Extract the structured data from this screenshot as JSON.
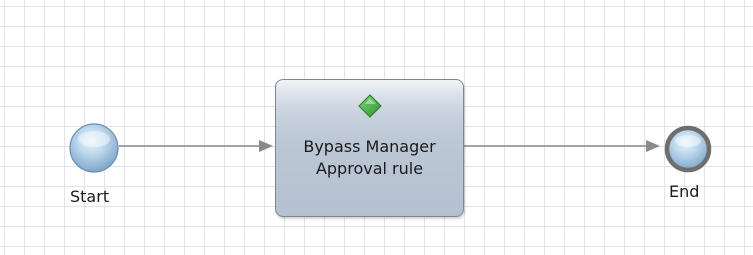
{
  "diagram": {
    "start": {
      "label": "Start"
    },
    "task": {
      "label_lines": [
        "Bypass Manager",
        "Approval rule"
      ],
      "icon": "green-diamond-icon"
    },
    "end": {
      "label": "End"
    }
  },
  "colors": {
    "grid": "#e3e3ee",
    "connector": "#8a8a8a",
    "task_border": "#7c8796",
    "diamond": "#3ea83e"
  }
}
